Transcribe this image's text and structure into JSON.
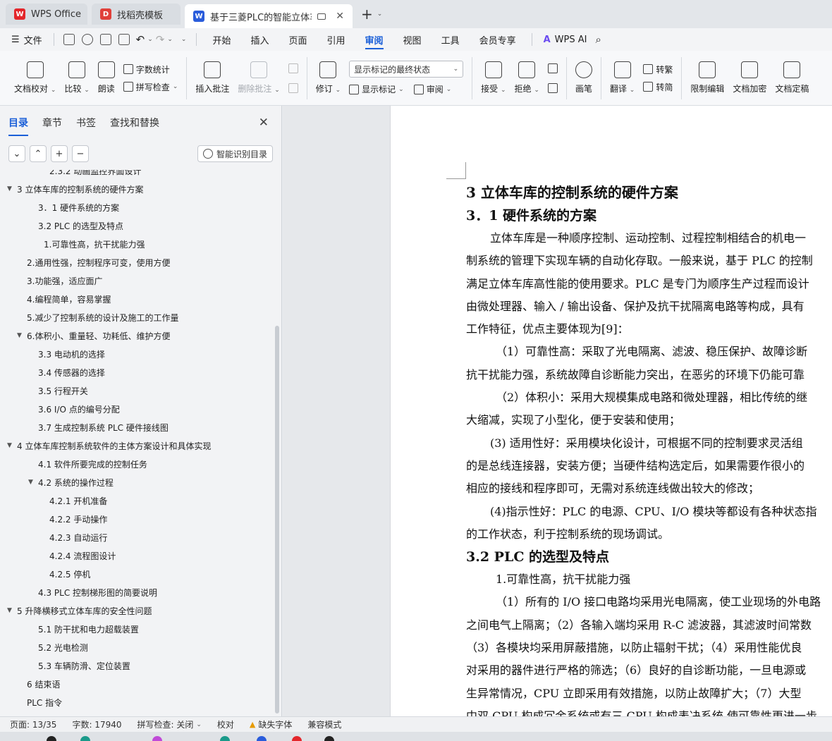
{
  "tabs": [
    {
      "label": "WPS Office",
      "icon": "wps-logo-icon",
      "state": "inactive"
    },
    {
      "label": "找稻壳模板",
      "icon": "template-logo-icon",
      "state": "inactive"
    },
    {
      "label": "基于三菱PLC的智能立体车库扌",
      "icon": "writer-logo-icon",
      "state": "active"
    }
  ],
  "menubar": {
    "file_label": "文件",
    "tabs": [
      "开始",
      "插入",
      "页面",
      "引用",
      "审阅",
      "视图",
      "工具",
      "会员专享"
    ],
    "active_tab": "审阅",
    "ai_label": "WPS AI"
  },
  "ribbon": {
    "proofread": "文档校对",
    "compare": "比较",
    "read_aloud": "朗读",
    "word_count": "字数统计",
    "spell_check": "拼写检查",
    "insert_comment": "插入批注",
    "delete_comment": "删除批注",
    "track": "修订",
    "markup_select": "显示标记的最终状态",
    "show_markup": "显示标记",
    "review": "审阅",
    "accept": "接受",
    "reject": "拒绝",
    "pen": "画笔",
    "translate": "翻译",
    "to_traditional": "转繁",
    "to_simplified": "转简",
    "restrict_edit": "限制编辑",
    "encrypt": "文档加密",
    "finalize": "文档定稿"
  },
  "leftpane": {
    "tabs": [
      "目录",
      "章节",
      "书签",
      "查找和替换"
    ],
    "active_tab": "目录",
    "smart_toc_label": "智能识别目录",
    "toc": [
      {
        "label": "2.3.2   动画监控界面设计",
        "level": 3,
        "arrow": ""
      },
      {
        "label": "3    立体车库的控制系统的硬件方案",
        "level": 1,
        "arrow": "▼"
      },
      {
        "label": "3．1    硬件系统的方案",
        "level": 2,
        "arrow": ""
      },
      {
        "label": "3.2    PLC 的选型及特点",
        "level": 2,
        "arrow": ""
      },
      {
        "label": "1.可靠性高，抗干扰能力强",
        "level": 2.5,
        "arrow": ""
      },
      {
        "label": "2.通用性强，控制程序可变，使用方便",
        "level": 0,
        "arrow": ""
      },
      {
        "label": "3.功能强，适应面广",
        "level": 0,
        "arrow": ""
      },
      {
        "label": "4.编程简单，容易掌握",
        "level": 0,
        "arrow": ""
      },
      {
        "label": "5.减少了控制系统的设计及施工的工作量",
        "level": 0,
        "arrow": ""
      },
      {
        "label": "6.体积小、重量轻、功耗低、维护方便",
        "level": 0,
        "arrow": "▼"
      },
      {
        "label": "3.3    电动机的选择",
        "level": 2,
        "arrow": ""
      },
      {
        "label": "3.4    传感器的选择",
        "level": 2,
        "arrow": ""
      },
      {
        "label": "3.5    行程开关",
        "level": 2,
        "arrow": ""
      },
      {
        "label": "3.6    I/O 点的编号分配",
        "level": 2,
        "arrow": ""
      },
      {
        "label": "3.7    生成控制系统 PLC 硬件接线图",
        "level": 2,
        "arrow": ""
      },
      {
        "label": "4    立体车库控制系统软件的主体方案设计和具体实现",
        "level": 1,
        "arrow": "▼"
      },
      {
        "label": "4.1    软件所要完成的控制任务",
        "level": 2,
        "arrow": ""
      },
      {
        "label": "4.2    系统的操作过程",
        "level": 2,
        "arrow": "▼"
      },
      {
        "label": "4.2.1    开机准备",
        "level": 3,
        "arrow": ""
      },
      {
        "label": "4.2.2    手动操作",
        "level": 3,
        "arrow": ""
      },
      {
        "label": "4.2.3    自动运行",
        "level": 3,
        "arrow": ""
      },
      {
        "label": "4.2.4    流程图设计",
        "level": 3,
        "arrow": ""
      },
      {
        "label": "4.2.5    停机",
        "level": 3,
        "arrow": ""
      },
      {
        "label": "4.3    PLC 控制梯形图的简要说明",
        "level": 2,
        "arrow": ""
      },
      {
        "label": "5    升降横移式立体车库的安全性问题",
        "level": 1,
        "arrow": "▼"
      },
      {
        "label": "5.1    防干扰和电力超载装置",
        "level": 2,
        "arrow": ""
      },
      {
        "label": "5.2    光电检测",
        "level": 2,
        "arrow": ""
      },
      {
        "label": "5.3    车辆防滑、定位装置",
        "level": 2,
        "arrow": ""
      },
      {
        "label": "6    结束语",
        "level": 1.5,
        "arrow": ""
      },
      {
        "label": "PLC 指令",
        "level": 1.5,
        "arrow": ""
      }
    ]
  },
  "document": {
    "lines": [
      {
        "type": "h1",
        "text": "3    立体车库的控制系统的硬件方案"
      },
      {
        "type": "h2",
        "text": "3．1    硬件系统的方案"
      },
      {
        "type": "p",
        "indent": 2,
        "text": "立体车库是一种顺序控制、运动控制、过程控制相结合的机电一"
      },
      {
        "type": "p",
        "indent": 0,
        "text": "制系统的管理下实现车辆的自动化存取。一般来说，基于 PLC 的控制"
      },
      {
        "type": "p",
        "indent": 0,
        "text": "满足立体车库高性能的使用要求。PLC 是专门为顺序生产过程而设计"
      },
      {
        "type": "p",
        "indent": 0,
        "text": "由微处理器、输入 / 输出设备、保护及抗干扰隔离电路等构成，具有"
      },
      {
        "type": "p",
        "indent": 0,
        "text": "工作特征，优点主要体现为[9]："
      },
      {
        "type": "p",
        "indent": 3,
        "text": "（1）可靠性高：采取了光电隔离、滤波、稳压保护、故障诊断"
      },
      {
        "type": "p",
        "indent": 0,
        "text": "抗干扰能力强，系统故障自诊断能力突出，在恶劣的环境下仍能可靠"
      },
      {
        "type": "p",
        "indent": 3,
        "text": "（2）体积小：采用大规模集成电路和微处理器，相比传统的继"
      },
      {
        "type": "p",
        "indent": 0,
        "text": "大缩减，实现了小型化，便于安装和使用；"
      },
      {
        "type": "p",
        "indent": 2,
        "text": "(3) 适用性好：采用模块化设计，可根据不同的控制要求灵活组"
      },
      {
        "type": "p",
        "indent": 0,
        "text": "的是总线连接器，安装方便；当硬件结构选定后，如果需要作很小的"
      },
      {
        "type": "p",
        "indent": 0,
        "text": "相应的接线和程序即可，无需对系统连线做出较大的修改；"
      },
      {
        "type": "p",
        "indent": 2,
        "text": "(4)指示性好：PLC 的电源、CPU、I/O 模块等都设有各种状态指"
      },
      {
        "type": "p",
        "indent": 0,
        "text": "的工作状态，利于控制系统的现场调试。"
      },
      {
        "type": "h2",
        "text": "3.2    PLC 的选型及特点"
      },
      {
        "type": "p",
        "indent": 3,
        "text": "1.可靠性高，抗干扰能力强"
      },
      {
        "type": "p",
        "indent": 3,
        "text": "（1）所有的 I/O 接口电路均采用光电隔离，使工业现场的外电路"
      },
      {
        "type": "p",
        "indent": 0,
        "text": "之间电气上隔离；（2）各输入端均采用 R-C 滤波器，其滤波时间常数"
      },
      {
        "type": "p",
        "indent": 0,
        "text": "（3）各模块均采用屏蔽措施，以防止辐射干扰；（4）采用性能优良"
      },
      {
        "type": "p",
        "indent": 0,
        "text": "对采用的器件进行严格的筛选；（6）良好的自诊断功能，一旦电源或"
      },
      {
        "type": "p",
        "indent": 0,
        "text": "生异常情况，CPU 立即采用有效措施，以防止故障扩大；（7）大型"
      },
      {
        "type": "p",
        "indent": 0,
        "text": "中双 CPU 构成冗余系统或有三 CPU 构成表决系统 使可靠性更进一步"
      }
    ]
  },
  "statusbar": {
    "page": "页面: 13/35",
    "words": "字数: 17940",
    "spell": "拼写检查: 关闭",
    "proof": "校对",
    "missing_font": "缺失字体",
    "compat": "兼容模式"
  }
}
